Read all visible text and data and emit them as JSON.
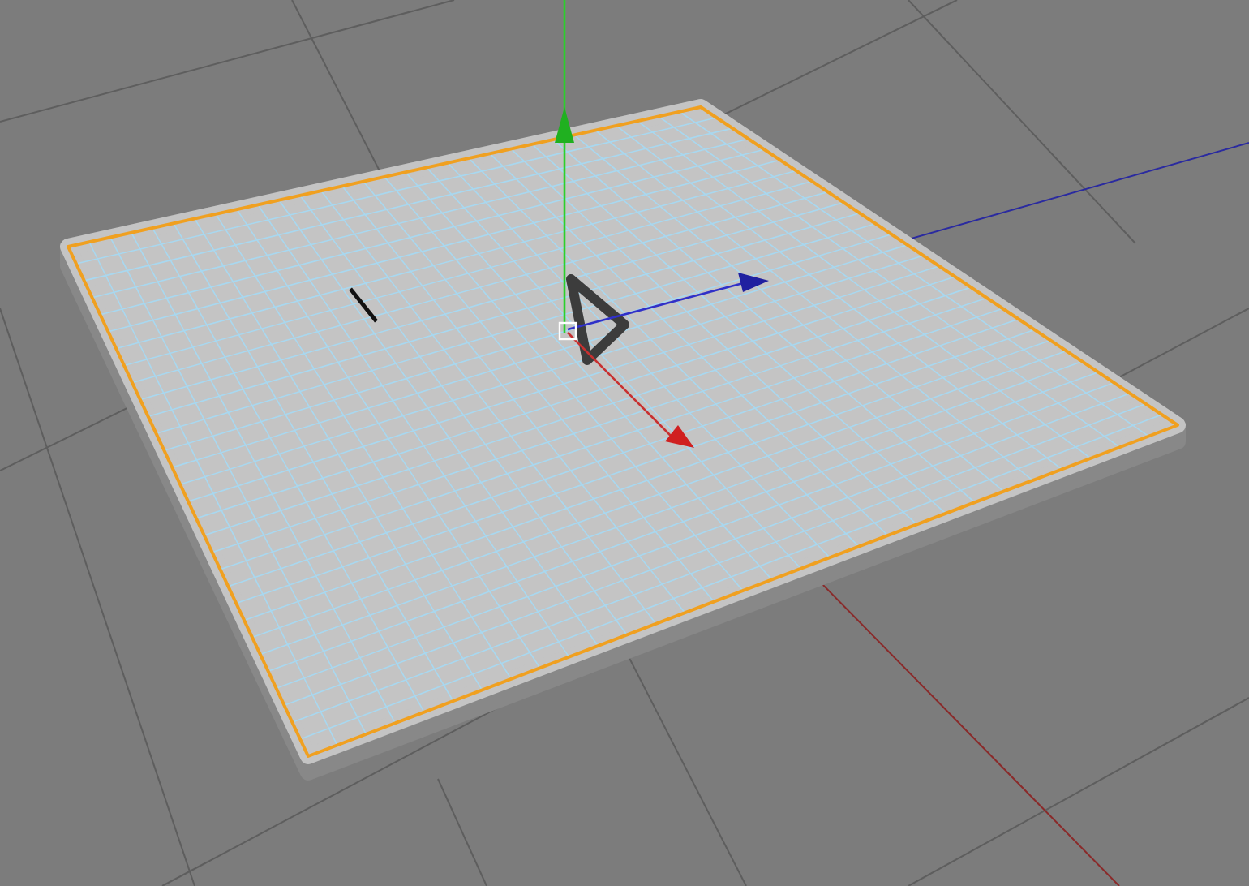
{
  "viewport": {
    "object": {
      "kind": "subdivided-plane",
      "selected": true
    }
  }
}
